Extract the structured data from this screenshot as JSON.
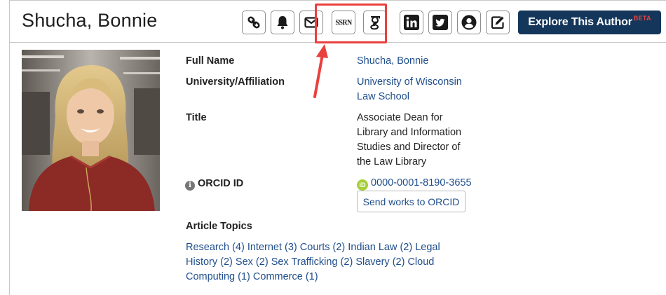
{
  "author": {
    "name": "Shucha, Bonnie"
  },
  "toolbar": {
    "icons": [
      {
        "name": "link-icon"
      },
      {
        "name": "bell-icon"
      },
      {
        "name": "envelope-icon"
      },
      {
        "name": "ssrn-icon",
        "text": "SSRN"
      },
      {
        "name": "google-scholar-icon"
      },
      {
        "name": "linkedin-icon",
        "text": "in"
      },
      {
        "name": "twitter-icon"
      },
      {
        "name": "user-circle-icon"
      },
      {
        "name": "edit-icon"
      }
    ],
    "explore_label": "Explore This Author",
    "beta_label": "BETA",
    "brand_color": "#15365b",
    "highlight_color": "#e8413e"
  },
  "profile": {
    "full_name_label": "Full Name",
    "full_name_value": "Shucha, Bonnie",
    "affiliation_label": "University/Affiliation",
    "affiliation_line1": "University of Wisconsin",
    "affiliation_line2": "Law School",
    "title_label": "Title",
    "title_lines": [
      "Associate Dean for",
      "Library and Information",
      "Studies and Director of",
      "the Law Library"
    ],
    "orcid_label": "ORCID ID",
    "orcid_badge": "iD",
    "orcid_value": "0000-0001-8190-3655",
    "send_orcid_label": "Send works to ORCID",
    "info_icon_text": "i"
  },
  "topics": {
    "label": "Article Topics",
    "items": [
      "Research (4)",
      "Internet (3)",
      "Courts (2)",
      "Indian Law (2)",
      "Legal History (2)",
      "Sex (2)",
      "Sex Trafficking (2)",
      "Slavery (2)",
      "Cloud Computing (1)",
      "Commerce (1)"
    ]
  },
  "colors": {
    "link": "#1f4e8c",
    "orcid_green": "#a6ce39"
  }
}
